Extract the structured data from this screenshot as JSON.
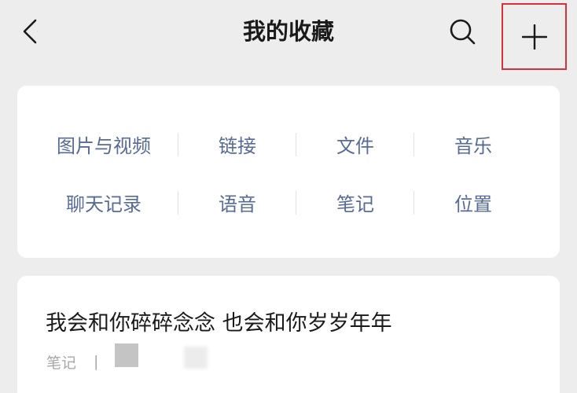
{
  "header": {
    "title": "我的收藏",
    "icons": {
      "back": "chevron-left-icon",
      "search": "search-icon",
      "add": "plus-icon"
    },
    "highlight_color": "#d9303a"
  },
  "categories": {
    "row1": [
      "图片与视频",
      "链接",
      "文件",
      "音乐"
    ],
    "row2": [
      "聊天记录",
      "语音",
      "笔记",
      "位置"
    ],
    "link_color": "#576b95"
  },
  "favorites": [
    {
      "text": "我会和你碎碎念念  也会和你岁岁年年",
      "type": "笔记",
      "separator": "|"
    }
  ]
}
